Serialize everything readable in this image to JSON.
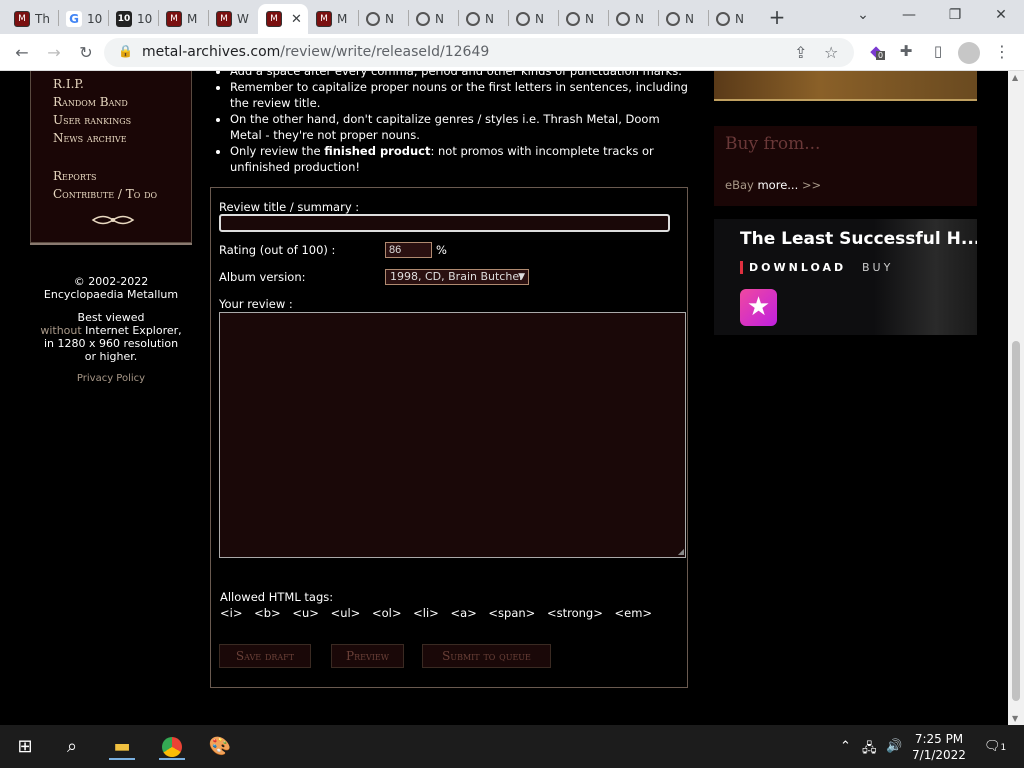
{
  "browser": {
    "tabs": [
      {
        "label": "Th",
        "icon": "ma"
      },
      {
        "label": "10",
        "icon": "google"
      },
      {
        "label": "10",
        "icon": "ten"
      },
      {
        "label": "M",
        "icon": "ma"
      },
      {
        "label": "W",
        "icon": "ma"
      },
      {
        "label": "",
        "icon": "ma",
        "active": true
      },
      {
        "label": "M",
        "icon": "ma"
      },
      {
        "label": "N",
        "icon": "globe"
      },
      {
        "label": "N",
        "icon": "globe"
      },
      {
        "label": "N",
        "icon": "globe"
      },
      {
        "label": "N",
        "icon": "globe"
      },
      {
        "label": "N",
        "icon": "globe"
      },
      {
        "label": "N",
        "icon": "globe"
      },
      {
        "label": "N",
        "icon": "globe"
      },
      {
        "label": "N",
        "icon": "globe"
      }
    ],
    "url_domain": "metal-archives.com",
    "url_path": "/review/write/releaseId/12649",
    "extension_badge": "0"
  },
  "sidebar": {
    "links": [
      "R.I.P.",
      "Random Band",
      "User rankings",
      "News archive",
      "Reports",
      "Contribute / To do"
    ],
    "copyright_line1": "© 2002-2022",
    "copyright_line2": "Encyclopaedia Metallum",
    "best_viewed": "Best viewed",
    "without": "without",
    "ie": " Internet Explorer,",
    "resolution": "in 1280 x 960 resolution",
    "or_higher": "or higher.",
    "privacy": "Privacy Policy"
  },
  "rules": {
    "r0": "Add a space after every comma, period and other kinds of punctuation marks.",
    "r1": "Remember to capitalize proper nouns or the first letters in sentences, including the review title.",
    "r2": "On the other hand, don't capitalize genres / styles i.e. Thrash Metal, Doom Metal - they're not proper nouns.",
    "r3_pre": "Only review the ",
    "r3_bold": "finished product",
    "r3_post": ": not promos with incomplete tracks or unfinished production!"
  },
  "form": {
    "title_label": "Review title / summary :",
    "title_value": "",
    "rating_label": "Rating (out of 100) :",
    "rating_value": "86",
    "percent": "%",
    "album_label": "Album version:",
    "album_value": "1998, CD, Brain Butcher",
    "review_label": "Your review :",
    "tags_label": "Allowed HTML tags:",
    "tags": "<i> <b> <u> <ul> <ol> <li> <a> <span> <strong> <em>",
    "save_label": "Save draft",
    "preview_label": "Preview",
    "submit_label": "Submit to queue"
  },
  "right": {
    "buy_heading": "Buy from...",
    "ebay": "eBay",
    "more": "more...",
    "arrows": ">>",
    "bc_title": "The Least Successful H...",
    "bc_download": "DOWNLOAD",
    "bc_buy": "BUY"
  },
  "taskbar": {
    "time": "7:25 PM",
    "date": "7/1/2022",
    "notif": "1"
  }
}
